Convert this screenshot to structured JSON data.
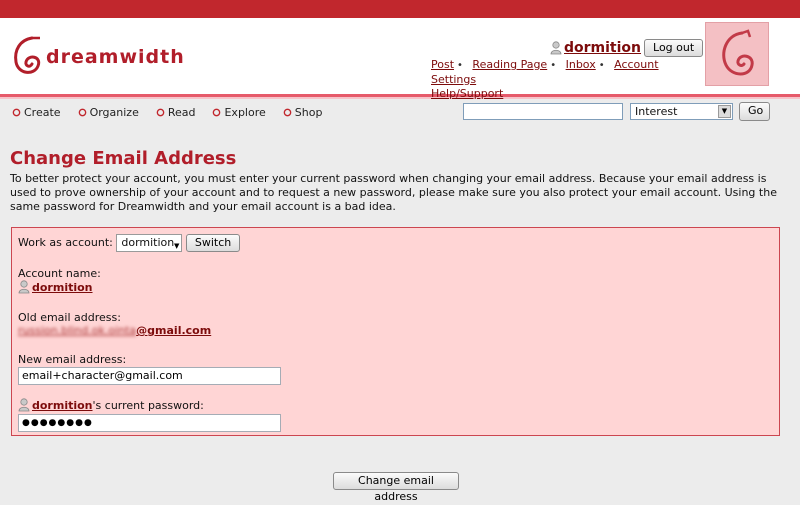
{
  "header": {
    "logo_text": "dreamwidth",
    "username": "dormition",
    "logout_label": "Log out",
    "links": [
      "Post",
      "Reading Page",
      "Inbox",
      "Account Settings",
      "Help/Support"
    ]
  },
  "nav": {
    "items": [
      "Create",
      "Organize",
      "Read",
      "Explore",
      "Shop"
    ],
    "search_value": "",
    "search_type_selected": "Interest",
    "go_label": "Go"
  },
  "page": {
    "title": "Change Email Address",
    "intro": "To better protect your account, you must enter your current password when changing your email address. Because your email address is used to prove ownership of your account and to request a new password, please make sure you also protect your email account. Using the same password for Dreamwidth and your email account is a bad idea."
  },
  "form": {
    "work_as_label": "Work as account:",
    "work_as_value": "dormition",
    "switch_label": "Switch",
    "account_name_label": "Account name:",
    "account_name": "dormition",
    "old_email_label": "Old email address:",
    "old_email_blurred": "russion.blind.ok.ointa",
    "old_email_domain": "@gmail.com",
    "new_email_label": "New email address:",
    "new_email_value": "email+character@gmail.com",
    "password_user": "dormition",
    "password_label_suffix": "'s current password:",
    "password_value": "●●●●●●●●",
    "submit_label": "Change email address"
  },
  "colors": {
    "brand_red": "#c1272d",
    "title_red": "#b11e2a",
    "link_red": "#7c0b0b",
    "form_bg": "#ffd5d5"
  }
}
